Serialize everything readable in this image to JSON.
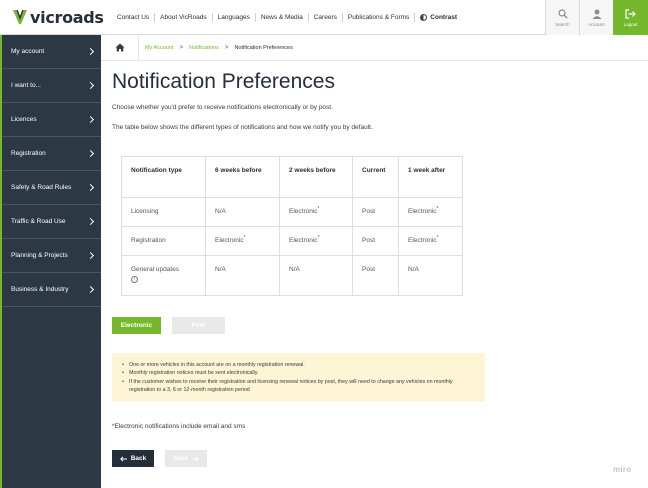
{
  "brand": {
    "name": "vicroads",
    "accent": "#75b82b",
    "dark": "#2d3845"
  },
  "topnav": {
    "items": [
      "Contact Us",
      "About VicRoads",
      "Languages",
      "News & Media",
      "Careers",
      "Publications & Forms"
    ],
    "contrast_label": "Contrast"
  },
  "utility": {
    "search_label": "Search",
    "account_label": "Account",
    "logout_label": "Logout"
  },
  "sidebar": {
    "items": [
      {
        "label": "My account"
      },
      {
        "label": "I want to..."
      },
      {
        "label": "Licences"
      },
      {
        "label": "Registration"
      },
      {
        "label": "Safety & Road Rules"
      },
      {
        "label": "Traffic & Road Use"
      },
      {
        "label": "Planning & Projects"
      },
      {
        "label": "Business & Industry"
      }
    ]
  },
  "breadcrumb": {
    "items": [
      "My Account",
      "Notifications"
    ],
    "current": "Notification Preferences",
    "separator": ">"
  },
  "page": {
    "title": "Notification Preferences",
    "intro": "Choose whether you'd prefer to receive notifications electronically or by post.",
    "intro2": "The table below shows the different types of notifications and how we notify you by default."
  },
  "table": {
    "headers": [
      "Notification type",
      "6 weeks before",
      "2 weeks before",
      "Current",
      "1 week after"
    ],
    "rows": [
      {
        "type": "Licensing",
        "c1": "N/A",
        "c2": "Electronic",
        "c2_mark": "*",
        "c3": "Post",
        "c4": "Electronic",
        "c4_mark": "*"
      },
      {
        "type": "Registration",
        "c1": "Electronic",
        "c1_mark": "*",
        "c2": "Electronic",
        "c2_mark": "*",
        "c3": "Post",
        "c4": "Electronic",
        "c4_mark": "*"
      },
      {
        "type": "General updates",
        "c1": "N/A",
        "c2": "N/A",
        "c3": "Post",
        "c4": "N/A"
      }
    ],
    "info_glyph": "i"
  },
  "buttons": {
    "electronic_label": "Electronic",
    "post_label": "Post",
    "back_label": "Back",
    "save_label": "Save"
  },
  "notice": {
    "items": [
      "One or more vehicles in this account are on a monthly registration renewal.",
      "Monthly registration notices must be sent electronically.",
      "If the customer wishes to receive their registration and licensing renewal notices by post, they will need to change any vehicles on monthly registration to a 3, 6 or 12-month registration period"
    ]
  },
  "footnote": "*Electronic notifications include email and sms",
  "watermark": "miro"
}
